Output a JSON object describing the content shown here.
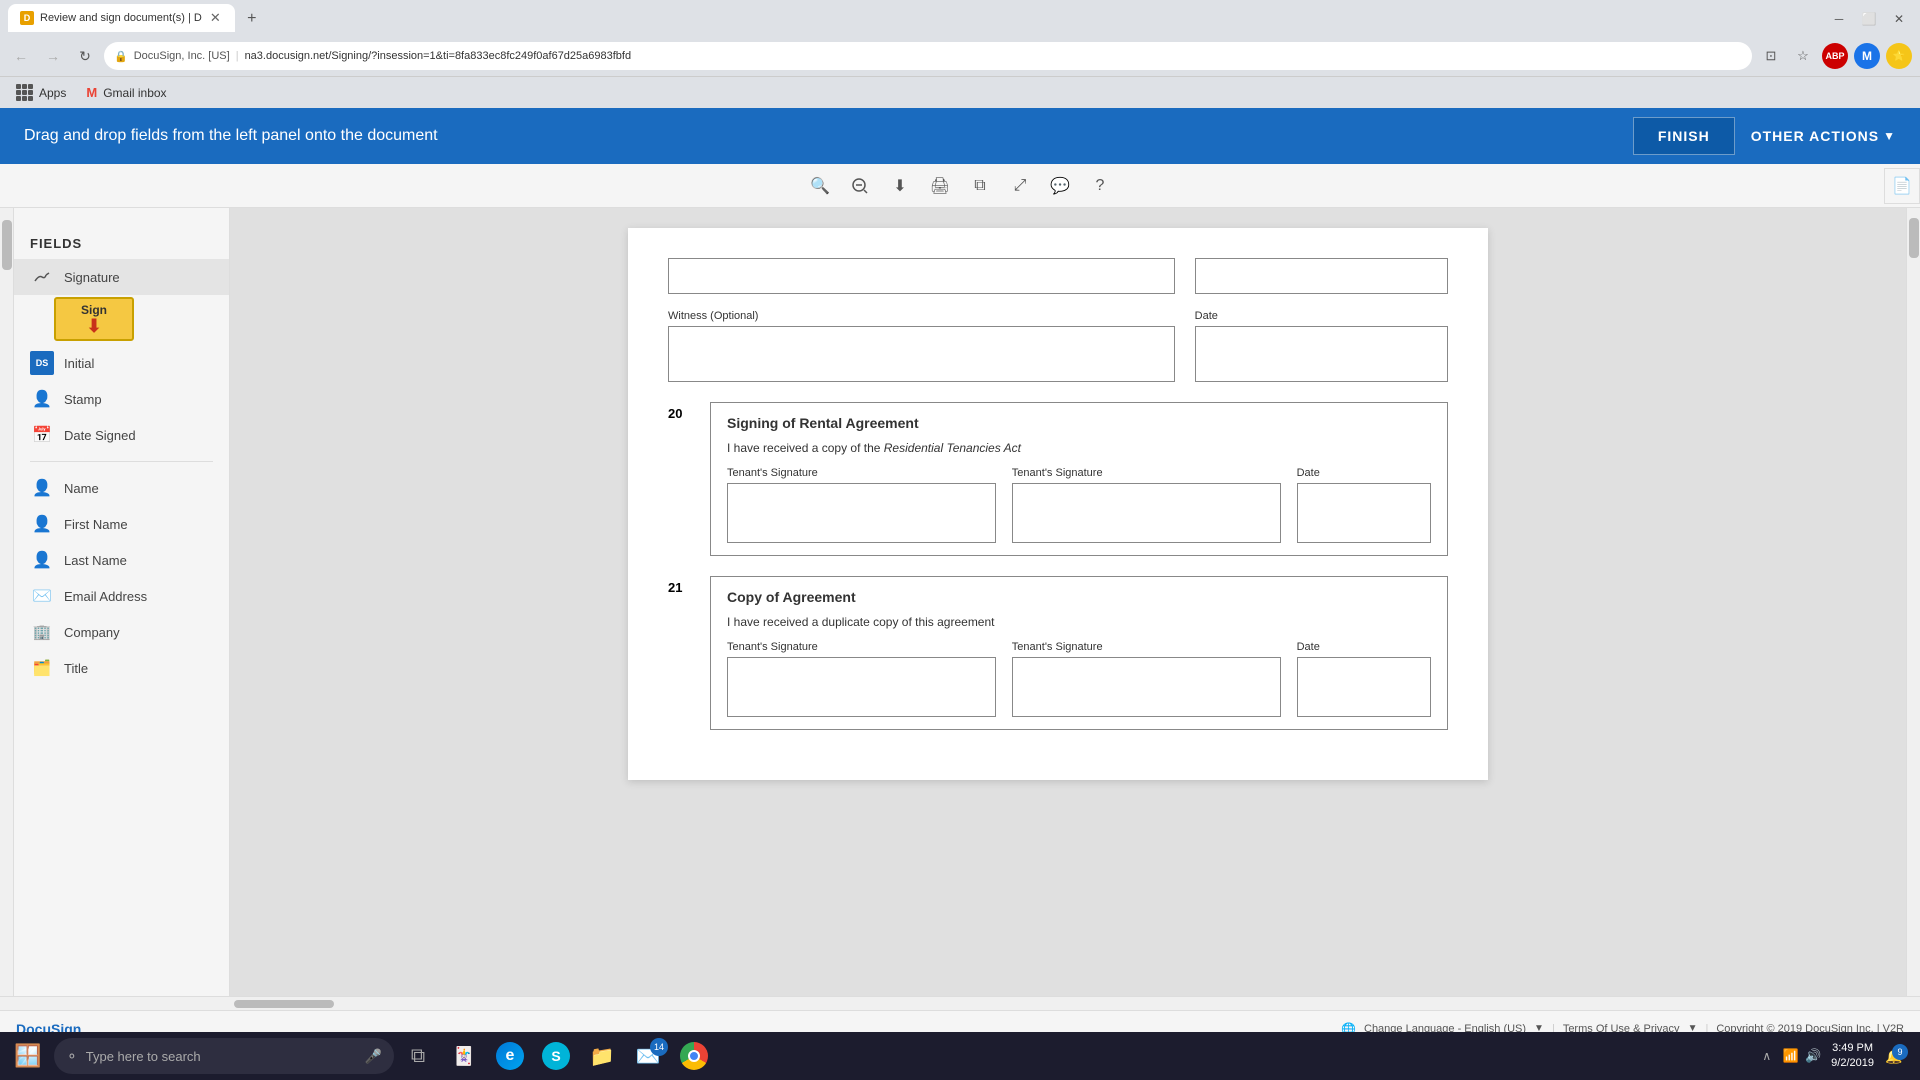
{
  "browser": {
    "tab": {
      "title": "Review and sign document(s) | D",
      "favicon": "🟡"
    },
    "address": {
      "secure_label": "DocuSign, Inc. [US]",
      "url": "na3.docusign.net/Signing/?insession=1&ti=8fa833ec8fc249f0af67d25a6983fbfd",
      "full": "DocuSign, Inc. [US]  |  na3.docusign.net/Signing/?insession=1&ti=8fa833ec8fc249f0af67d25a6983fbfd"
    },
    "bookmarks": {
      "apps_label": "Apps",
      "gmail_label": "Gmail inbox"
    }
  },
  "docusign_banner": {
    "instruction": "Drag and drop fields from the left panel onto the document",
    "finish_label": "FINISH",
    "other_actions_label": "OTHER ACTIONS"
  },
  "toolbar": {
    "zoom_in": "zoom-in",
    "zoom_out": "zoom-out",
    "download": "download",
    "print": "print",
    "copy": "copy",
    "expand": "expand",
    "comment": "comment",
    "help": "help"
  },
  "fields_panel": {
    "header": "FIELDS",
    "items": [
      {
        "id": "signature",
        "label": "Signature",
        "icon": "✏️"
      },
      {
        "id": "initial",
        "label": "Initial",
        "icon": "DS"
      },
      {
        "id": "stamp",
        "label": "Stamp",
        "icon": "👤"
      },
      {
        "id": "date_signed",
        "label": "Date Signed",
        "icon": "📅"
      },
      {
        "id": "name",
        "label": "Name",
        "icon": "👤"
      },
      {
        "id": "first_name",
        "label": "First Name",
        "icon": "👤"
      },
      {
        "id": "last_name",
        "label": "Last Name",
        "icon": "👤"
      },
      {
        "id": "email_address",
        "label": "Email Address",
        "icon": "✉️"
      },
      {
        "id": "company",
        "label": "Company",
        "icon": "🏢"
      },
      {
        "id": "title",
        "label": "Title",
        "icon": "🗂️"
      }
    ],
    "sign_tooltip": "Sign"
  },
  "document": {
    "witness_section": {
      "witness_label": "Witness (Optional)",
      "date_label": "Date"
    },
    "section20": {
      "number": "20",
      "title": "Signing of Rental Agreement",
      "text_before": "I have received a copy of the ",
      "text_italic": "Residential Tenancies Act",
      "tenant_sig1_label": "Tenant's Signature",
      "tenant_sig2_label": "Tenant's Signature",
      "date_label": "Date"
    },
    "section21": {
      "number": "21",
      "title": "Copy of Agreement",
      "text": "I have received a duplicate copy of this agreement",
      "tenant_sig1_label": "Tenant's Signature",
      "tenant_sig2_label": "Tenant's Signature",
      "date_label": "Date"
    }
  },
  "footer": {
    "language_label": "Change Language - English (US)",
    "terms_label": "Terms Of Use & Privacy",
    "copyright": "Copyright © 2019 DocuSign Inc. | V2R"
  },
  "taskbar": {
    "search_placeholder": "Type here to search",
    "time": "3:49 PM",
    "date": "9/2/2019",
    "notification_count": "9",
    "email_badge": "14"
  }
}
